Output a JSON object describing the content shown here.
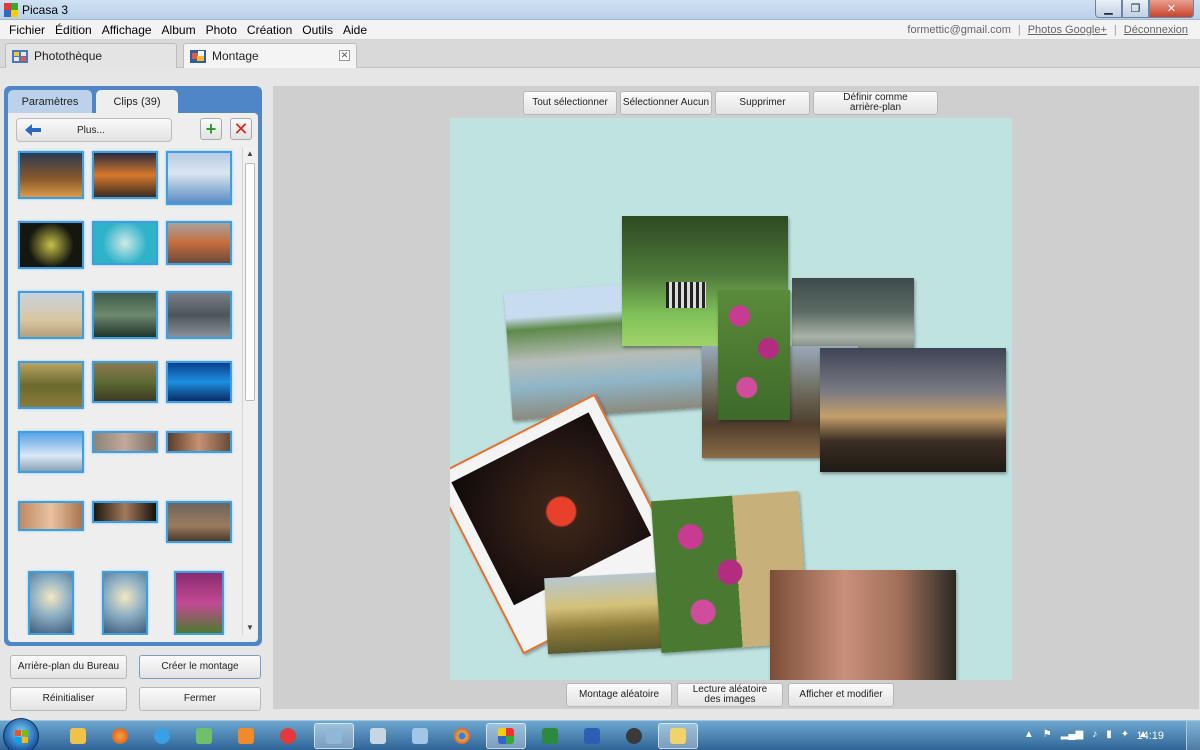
{
  "window": {
    "title": "Picasa 3"
  },
  "menu": [
    "Fichier",
    "Édition",
    "Affichage",
    "Album",
    "Photo",
    "Création",
    "Outils",
    "Aide"
  ],
  "account": {
    "email": "formettic@gmail.com",
    "photos_link": "Photos Google+",
    "logout_link": "Déconnexion",
    "separator": "|"
  },
  "tabs": {
    "library": "Photothèque",
    "montage": "Montage"
  },
  "left_panel": {
    "tab_settings": "Paramètres",
    "tab_clips": "Clips (39)",
    "more_button": "Plus...",
    "add_icon": "+",
    "remove_icon": "✕"
  },
  "top_buttons": {
    "select_all": "Tout sélectionner",
    "select_none": "Sélectionner Aucun",
    "delete": "Supprimer",
    "set_background": "Définir comme arrière-plan"
  },
  "bottom_buttons": {
    "random_montage": "Montage aléatoire",
    "random_play": "Lecture aléatoire des images",
    "view_edit": "Afficher et modifier"
  },
  "left_buttons": {
    "desktop_bg": "Arrière-plan du Bureau",
    "create": "Créer le montage",
    "reset": "Réinitialiser",
    "close": "Fermer"
  },
  "taskbar": {
    "clock": "14:19"
  },
  "colors": {
    "panel_blue": "#4f86c8",
    "canvas_bg": "#bfe3e0",
    "selection_frame": "#e8702f",
    "thumb_border": "#3d9fe0"
  }
}
